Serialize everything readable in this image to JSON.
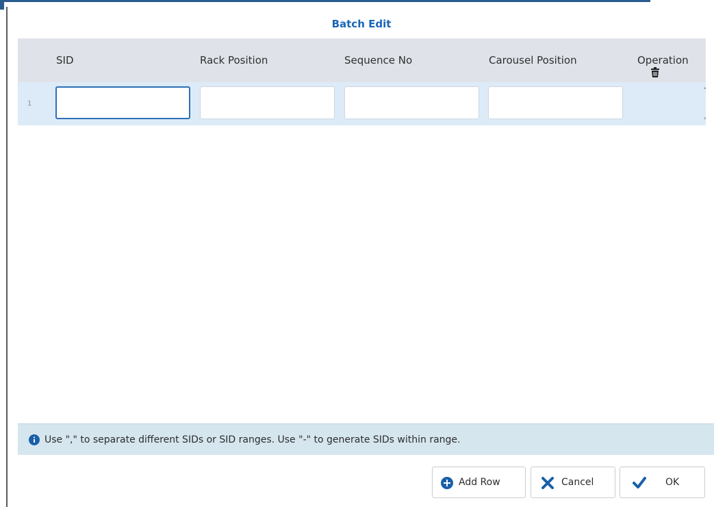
{
  "dialog": {
    "title": "Batch Edit"
  },
  "grid": {
    "columns": [
      "SID",
      "Rack Position",
      "Sequence No",
      "Carousel Position",
      "Operation"
    ],
    "rows": [
      {
        "index": "1",
        "sid": "",
        "rack_position": "",
        "sequence_no": "",
        "carousel_position": "",
        "operation_icon": "trash-icon"
      }
    ]
  },
  "info": {
    "icon": "info-circle-icon",
    "text": "Use \",\" to separate different SIDs or SID ranges. Use \"-\" to generate SIDs within range."
  },
  "buttons": {
    "add_row": "Add Row",
    "add_row_icon": "plus-circle-icon",
    "cancel": "Cancel",
    "cancel_icon": "x-icon",
    "ok": "OK",
    "ok_icon": "check-icon"
  },
  "colors": {
    "title": "#1a66b8",
    "header_bg": "#dfe3e9",
    "row_bg": "#dcebf7",
    "info_bg": "#d6e6ef",
    "focus_border": "#2d6fb5",
    "accent_blue": "#1a5fa8"
  }
}
